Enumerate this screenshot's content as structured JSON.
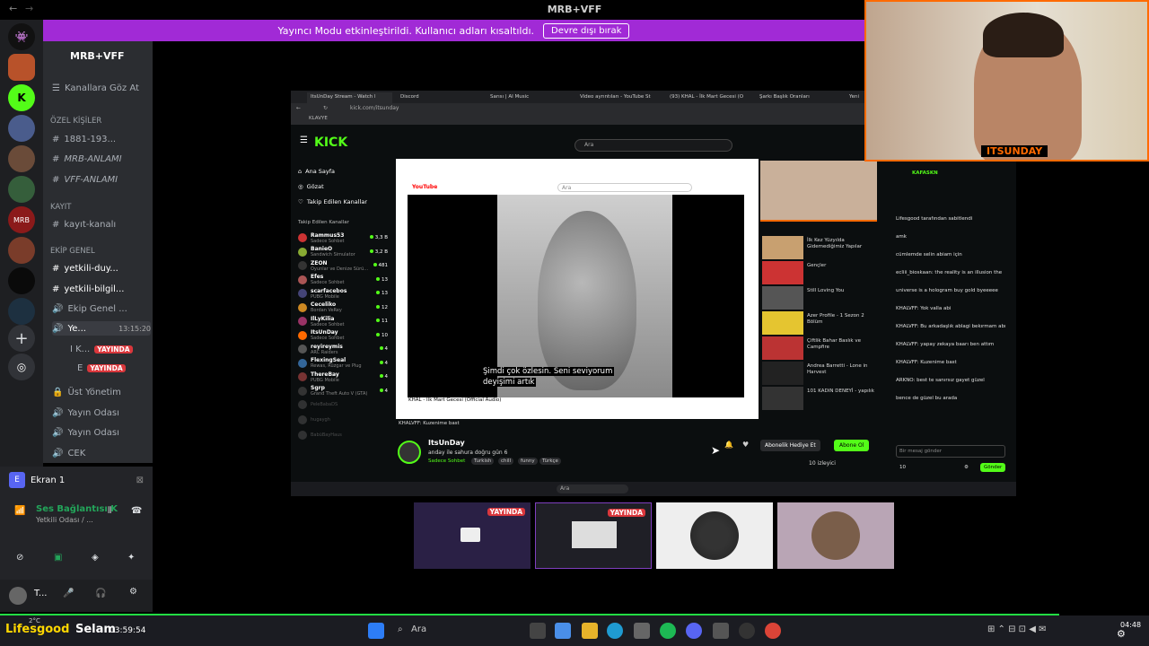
{
  "window": {
    "title": "MRB+VFF"
  },
  "banner": {
    "text": "Yayıncı Modu etkinleştirildi. Kullanıcı adları kısaltıldı.",
    "button": "Devre dışı bırak"
  },
  "discord": {
    "server_name": "MRB+VFF",
    "browse": "Kanallara Göz At",
    "categories": [
      "ÖZEL KİŞİLER",
      "KAYIT",
      "EKİP GENEL"
    ],
    "channels": [
      "1881-193...",
      "MRB-ANLAMI",
      "VFF-ANLAMI",
      "kayıt-kanalı",
      "yetkili-duy...",
      "yetkili-bilgil...",
      "Ekip Genel ...",
      "Ye...",
      "Üst Yönetim",
      "Yayın Odası",
      "Yayın Odası",
      "CEK"
    ],
    "voice_time": "13:15:20",
    "voice_users": [
      "I K...",
      "E"
    ],
    "live_badge": "YAYINDA",
    "screen_share": "Ekran 1",
    "connection_title": "Ses Bağlantısı K",
    "connection_sub": "Yetkili Odası / ...",
    "user_short": "T..."
  },
  "browser": {
    "tabs": [
      "ItsUnDay Stream - Watch l",
      "Discord",
      "Sarısı | AI Music",
      "Video ayrıntıları - YouTube St",
      "(93) KHAL - İlk Mart Gecesi (O",
      "Şarkı Başlık Oranları",
      "Yeni"
    ],
    "url": "kick.com/itsunday",
    "bookmarks": [
      "KLAVYE"
    ]
  },
  "kick": {
    "logo": "KICK",
    "search": "Ara",
    "nav": [
      "Ana Sayfa",
      "Gözat",
      "Takip Edilen Kanallar"
    ],
    "followed_title": "Takip Edilen Kanallar",
    "streams": [
      {
        "name": "Rammus53",
        "cat": "Sadece Sohbet",
        "viewers": "3,3 B"
      },
      {
        "name": "BanieO",
        "cat": "Sandwich Simulator",
        "viewers": "3,2 B"
      },
      {
        "name": "ZEON",
        "cat": "Oyunlar ve Denize Sürü...",
        "viewers": "481"
      },
      {
        "name": "Efes",
        "cat": "Sadece Sohbet",
        "viewers": "13"
      },
      {
        "name": "scarfacebos",
        "cat": "PUBG Mobile",
        "viewers": "13"
      },
      {
        "name": "Ceceliko",
        "cat": "Bordan VeRey",
        "viewers": "12"
      },
      {
        "name": "IlLyKilia",
        "cat": "Sadece Sohbet",
        "viewers": "11"
      },
      {
        "name": "ItsUnDay",
        "cat": "Sadece Sohbet",
        "viewers": "10"
      },
      {
        "name": "reyireymis",
        "cat": "ARC Raiders",
        "viewers": "4"
      },
      {
        "name": "FlexingSeal",
        "cat": "Rewas, Rüzgar ve Plug",
        "viewers": "4"
      },
      {
        "name": "ThereBay",
        "cat": "PUBG Mobile",
        "viewers": "4"
      },
      {
        "name": "Sgrp",
        "cat": "Grand Theft Auto V (GTA)",
        "viewers": "4"
      }
    ],
    "offline": [
      "PeleBabaDS",
      "hugaygh",
      "BabüBayHaus"
    ],
    "channel": {
      "name": "ItsUnDay",
      "title": "anday ile sahura doğru gün 6",
      "category": "Sadece Sohbet",
      "tags": [
        "Turkish",
        "chill",
        "funny",
        "Türkçe"
      ],
      "viewers": "10 izleyici",
      "gift": "Abonelik Hediye Et",
      "sub": "Abone Ol"
    },
    "chat_header": "KAFASKN",
    "chat_messages": [
      "Lifesgood tarafından sabitlendi",
      "amk",
      "cümlemde selin abiam için",
      "ecliii_bioskaan: the reality is an illusion the",
      "universe is a hologram buy gold byeeeee",
      "KHALVFF: Yok valla abi",
      "KHALVFF: Bu arkadaşlık ablagi bekırmam abı",
      "KHALVFF: yapay zekaya baarı ben attım",
      "KHALVFF: Kuzenime bast",
      "ARKNO: best te sanırsız gayet güzel",
      "bence de güzel bu arada"
    ],
    "chat_input": "Bir mesaj gönder",
    "chat_send": "Gönder",
    "chat_count": "10"
  },
  "youtube": {
    "logo": "YouTube",
    "search": "Ara",
    "video_title": "KHAL - İlk Mart Gecesi (Official Audio)",
    "subtitle": [
      "Şimdi çok özlesin. Seni seviyorum",
      "deyişimi artık"
    ],
    "status_bar": "KHALVFF: Kuzenime bast",
    "recs": [
      "İlk Kez Yüzyılda Gidemediğimiz Yapılar",
      "Gençler",
      "Still Loving You",
      "Azer Profile - 1 Sezon 2 Bölüm",
      "Çiftlik Bahar Baslık ve Campfire",
      "Andrea Barretti - Lone in Harvest",
      "101 KADIN DENEYİ - yapılık"
    ]
  },
  "webcam": {
    "label": "ITSUNDAY"
  },
  "taskbar": {
    "overlay_name": "Lifesgood",
    "overlay_msg": "Selam",
    "overlay_time": "03:59:54",
    "search": "Ara",
    "time": "04:48",
    "temp": "2°C"
  },
  "thumbnails": {
    "live_badge": "YAYINDA"
  }
}
